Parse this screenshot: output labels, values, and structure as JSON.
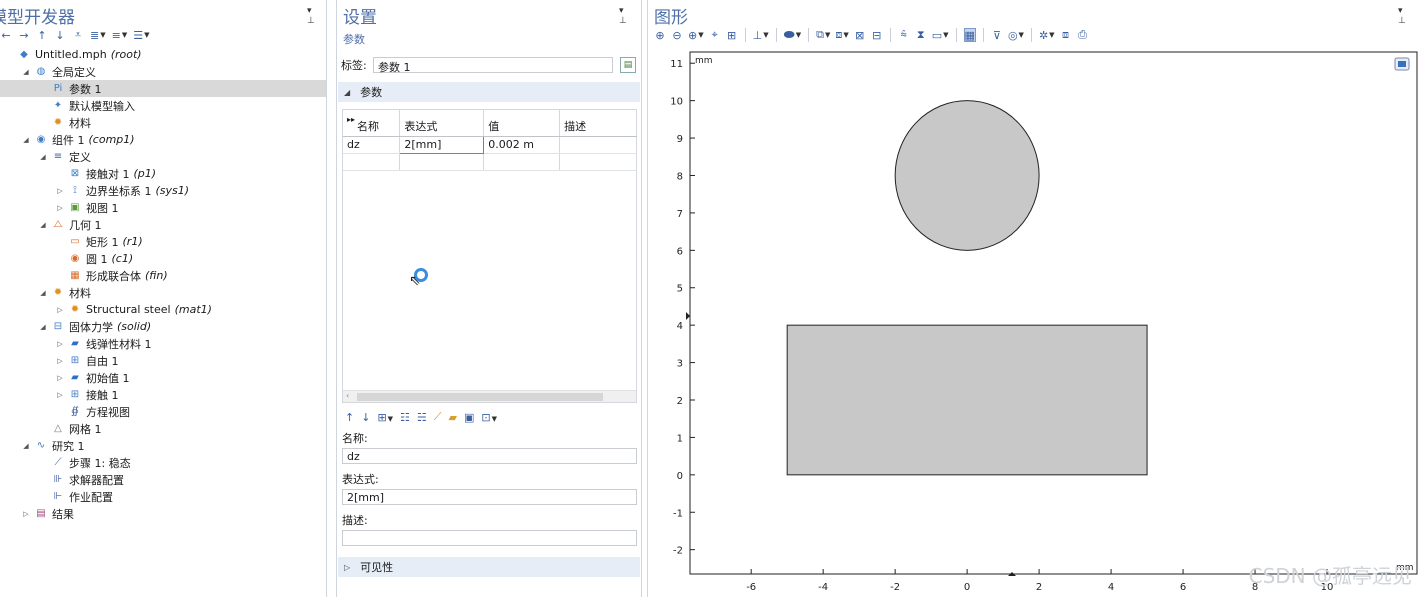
{
  "model": {
    "title": "模型开发器",
    "tree": [
      {
        "label": "Untitled.mph",
        "tag": "(root)",
        "level": 0,
        "arrow": "",
        "icon": "model-file-icon",
        "glyph": "◆",
        "color": "#3f7dc8"
      },
      {
        "label": "全局定义",
        "tag": "",
        "level": 1,
        "arrow": "◢",
        "icon": "globe-icon",
        "glyph": "◍",
        "color": "#3f7dc8"
      },
      {
        "label": "参数 1",
        "tag": "",
        "level": 2,
        "arrow": "",
        "icon": "parameters-icon",
        "glyph": "Pi",
        "color": "#3f7dc8",
        "selected": true
      },
      {
        "label": "默认模型输入",
        "tag": "",
        "level": 2,
        "arrow": "",
        "icon": "model-input-icon",
        "glyph": "✦",
        "color": "#3f7dc8"
      },
      {
        "label": "材料",
        "tag": "",
        "level": 2,
        "arrow": "",
        "icon": "material-icon",
        "glyph": "✹",
        "color": "#e0901f"
      },
      {
        "label": "组件 1",
        "tag": "(comp1)",
        "level": 1,
        "arrow": "◢",
        "icon": "component-icon",
        "glyph": "◉",
        "color": "#3f7dc8"
      },
      {
        "label": "定义",
        "tag": "",
        "level": 2,
        "arrow": "◢",
        "icon": "definitions-icon",
        "glyph": "≡",
        "color": "#3f5f9f"
      },
      {
        "label": "接触对 1",
        "tag": "(p1)",
        "level": 3,
        "arrow": "",
        "icon": "contact-pair-icon",
        "glyph": "⊠",
        "color": "#3f7dc8"
      },
      {
        "label": "边界坐标系 1",
        "tag": "(sys1)",
        "level": 3,
        "arrow": "▷",
        "icon": "coordinate-system-icon",
        "glyph": "⟟",
        "color": "#3f7dc8"
      },
      {
        "label": "视图 1",
        "tag": "",
        "level": 3,
        "arrow": "▷",
        "icon": "view-icon",
        "glyph": "▣",
        "color": "#5a9a3a"
      },
      {
        "label": "几何 1",
        "tag": "",
        "level": 2,
        "arrow": "◢",
        "icon": "geometry-icon",
        "glyph": "⧍",
        "color": "#d86a2a"
      },
      {
        "label": "矩形 1",
        "tag": "(r1)",
        "level": 3,
        "arrow": "",
        "icon": "rectangle-icon",
        "glyph": "▭",
        "color": "#d86a2a"
      },
      {
        "label": "圆 1",
        "tag": "(c1)",
        "level": 3,
        "arrow": "",
        "icon": "circle-icon",
        "glyph": "◉",
        "color": "#d86a2a"
      },
      {
        "label": "形成联合体",
        "tag": "(fin)",
        "level": 3,
        "arrow": "",
        "icon": "form-union-icon",
        "glyph": "▦",
        "color": "#d86a2a"
      },
      {
        "label": "材料",
        "tag": "",
        "level": 2,
        "arrow": "◢",
        "icon": "materials-icon",
        "glyph": "✹",
        "color": "#e0901f"
      },
      {
        "label": "Structural steel",
        "tag": "(mat1)",
        "level": 3,
        "arrow": "▷",
        "icon": "material-steel-icon",
        "glyph": "✹",
        "color": "#e0901f"
      },
      {
        "label": "固体力学",
        "tag": "(solid)",
        "level": 2,
        "arrow": "◢",
        "icon": "solid-mechanics-icon",
        "glyph": "⊟",
        "color": "#3f7dc8"
      },
      {
        "label": "线弹性材料 1",
        "tag": "",
        "level": 3,
        "arrow": "▷",
        "icon": "linear-elastic-icon",
        "glyph": "▰",
        "color": "#2a6fc9"
      },
      {
        "label": "自由 1",
        "tag": "",
        "level": 3,
        "arrow": "▷",
        "icon": "free-icon",
        "glyph": "⊞",
        "color": "#3f7dc8"
      },
      {
        "label": "初始值 1",
        "tag": "",
        "level": 3,
        "arrow": "▷",
        "icon": "initial-values-icon",
        "glyph": "▰",
        "color": "#2a6fc9"
      },
      {
        "label": "接触 1",
        "tag": "",
        "level": 3,
        "arrow": "▷",
        "icon": "contact-icon",
        "glyph": "⊞",
        "color": "#3f7dc8"
      },
      {
        "label": "方程视图",
        "tag": "",
        "level": 3,
        "arrow": "",
        "icon": "equation-view-icon",
        "glyph": "∯",
        "color": "#3f5f9f"
      },
      {
        "label": "网格 1",
        "tag": "",
        "level": 2,
        "arrow": "",
        "icon": "mesh-icon",
        "glyph": "△",
        "color": "#777"
      },
      {
        "label": "研究 1",
        "tag": "",
        "level": 1,
        "arrow": "◢",
        "icon": "study-icon",
        "glyph": "∿",
        "color": "#3f7dc8"
      },
      {
        "label": "步骤 1: 稳态",
        "tag": "",
        "level": 2,
        "arrow": "",
        "icon": "step-icon",
        "glyph": "⟋",
        "color": "#3f5f9f"
      },
      {
        "label": "求解器配置",
        "tag": "",
        "level": 2,
        "arrow": "",
        "icon": "solver-config-icon",
        "glyph": "⊪",
        "color": "#3f5f9f"
      },
      {
        "label": "作业配置",
        "tag": "",
        "level": 2,
        "arrow": "",
        "icon": "job-config-icon",
        "glyph": "⊩",
        "color": "#3f5f9f"
      },
      {
        "label": "结果",
        "tag": "",
        "level": 1,
        "arrow": "▷",
        "icon": "results-icon",
        "glyph": "▤",
        "color": "#a04a7a"
      }
    ]
  },
  "settings": {
    "title": "设置",
    "subtitle": "参数",
    "label_caption": "标签:",
    "label_value": "参数 1",
    "section_params": "参数",
    "table_headers": [
      "名称",
      "表达式",
      "值",
      "描述"
    ],
    "table_rows": [
      [
        "dz",
        "2[mm]",
        "0.002 m",
        ""
      ],
      [
        "",
        "",
        "",
        ""
      ]
    ],
    "name_caption": "名称:",
    "name_value": "dz",
    "expr_caption": "表达式:",
    "expr_value": "2[mm]",
    "desc_caption": "描述:",
    "desc_value": "",
    "section_visibility": "可见性"
  },
  "graphics": {
    "title": "图形",
    "unit": "mm",
    "watermark": "CSDN @孤亭远见"
  },
  "chart_data": {
    "type": "scatter",
    "title": "",
    "xlabel": "mm",
    "ylabel": "mm",
    "xticks": [
      -6,
      -4,
      -2,
      0,
      2,
      4,
      6,
      8,
      10
    ],
    "yticks": [
      -2,
      -1,
      0,
      1,
      2,
      3,
      4,
      5,
      6,
      7,
      8,
      9,
      10,
      11
    ],
    "xlim": [
      -7.7,
      12.5
    ],
    "ylim": [
      -2.65,
      11.3
    ],
    "grid": false,
    "shapes": [
      {
        "kind": "rectangle",
        "x0": -5,
        "y0": 0,
        "x1": 5,
        "y1": 4,
        "fill": "#c8c8c8"
      },
      {
        "kind": "circle",
        "cx": 0,
        "cy": 8,
        "r": 2,
        "fill": "#c8c8c8"
      }
    ]
  }
}
